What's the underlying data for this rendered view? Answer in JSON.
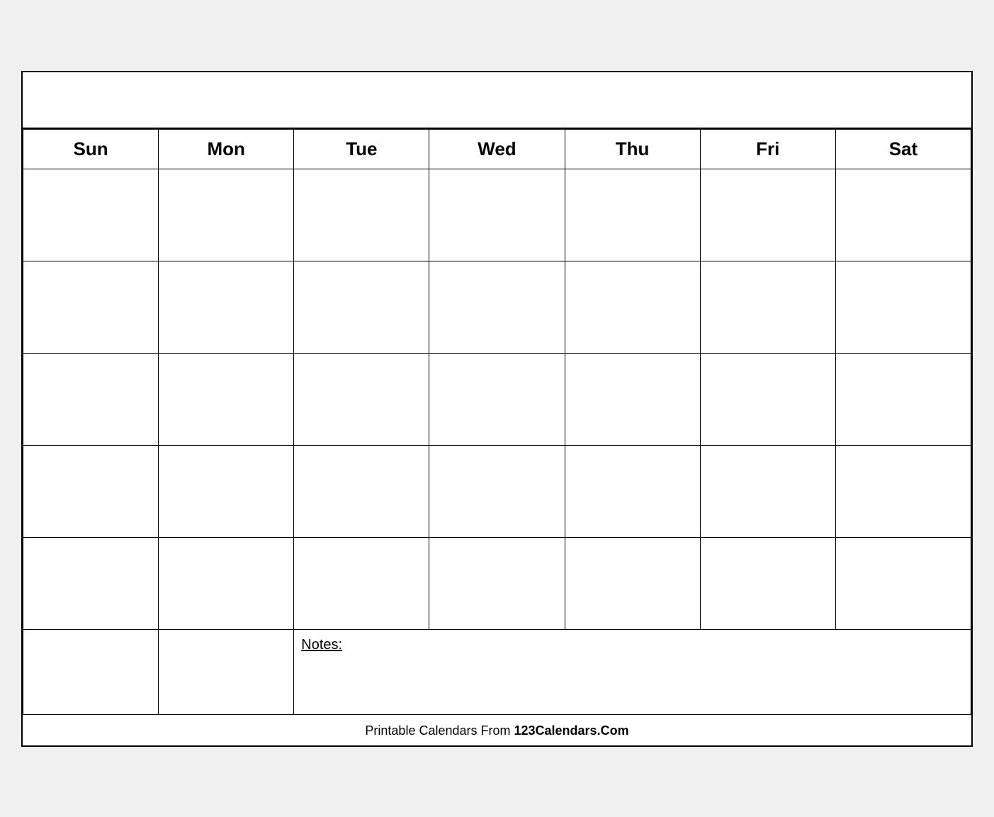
{
  "calendar": {
    "title": "",
    "days": [
      "Sun",
      "Mon",
      "Tue",
      "Wed",
      "Thu",
      "Fri",
      "Sat"
    ],
    "num_rows": 5,
    "notes_label": "Notes:"
  },
  "footer": {
    "text_normal": "Printable Calendars From ",
    "text_bold": "123Calendars.Com"
  }
}
